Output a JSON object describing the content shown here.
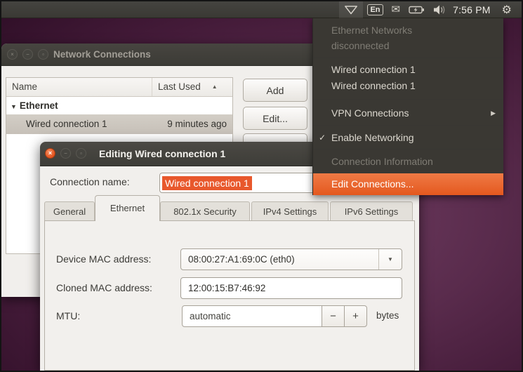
{
  "panel": {
    "keyboard_indicator": "En",
    "clock": "7:56 PM"
  },
  "network_menu": {
    "items": {
      "ethernet_networks": "Ethernet Networks",
      "disconnected": "disconnected",
      "wired1": "Wired connection 1",
      "wired2": "Wired connection 1",
      "vpn": "VPN Connections",
      "enable_networking": "Enable Networking",
      "connection_information": "Connection Information",
      "edit_connections": "Edit Connections..."
    }
  },
  "connections_window": {
    "title": "Network Connections",
    "col_name": "Name",
    "col_last_used": "Last Used",
    "group_label": "Ethernet",
    "row": {
      "name": "Wired connection 1",
      "last_used": "9 minutes ago"
    },
    "add_button": "Add",
    "edit_button": "Edit..."
  },
  "edit_dialog": {
    "title": "Editing Wired connection 1",
    "connection_name_label": "Connection name:",
    "connection_name_value": "Wired connection 1",
    "tabs": [
      "General",
      "Ethernet",
      "802.1x Security",
      "IPv4 Settings",
      "IPv6 Settings"
    ],
    "active_tab": "Ethernet",
    "device_mac_label": "Device MAC address:",
    "device_mac_value": "08:00:27:A1:69:0C (eth0)",
    "cloned_mac_label": "Cloned MAC address:",
    "cloned_mac_value": "12:00:15:B7:46:92",
    "mtu_label": "MTU:",
    "mtu_value": "automatic",
    "mtu_unit": "bytes"
  },
  "colors": {
    "accent_orange": "#e8582c",
    "menu_highlight_top": "#ef7a45",
    "menu_highlight_bottom": "#e4581f",
    "panel_bg": "#3c3b37",
    "window_bg": "#f1efec",
    "desktop_center": "#6e3c60",
    "desktop_edge": "#2e0e26",
    "selected_row": "#cbc5bc"
  }
}
